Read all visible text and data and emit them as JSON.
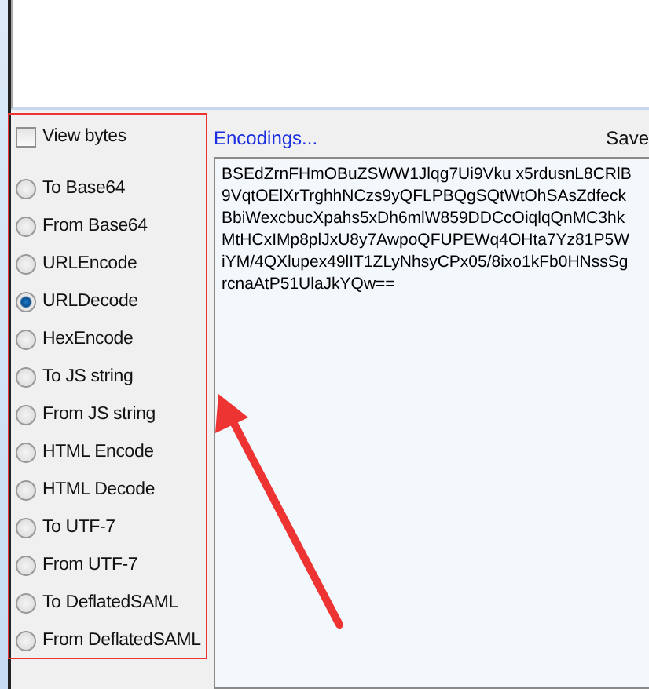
{
  "options": {
    "view_bytes": {
      "label": "View bytes",
      "checked": false
    },
    "transforms": [
      {
        "label": "To Base64",
        "selected": false
      },
      {
        "label": "From Base64",
        "selected": false
      },
      {
        "label": "URLEncode",
        "selected": false
      },
      {
        "label": "URLDecode",
        "selected": true
      },
      {
        "label": "HexEncode",
        "selected": false
      },
      {
        "label": "To JS string",
        "selected": false
      },
      {
        "label": "From JS string",
        "selected": false
      },
      {
        "label": "HTML Encode",
        "selected": false
      },
      {
        "label": "HTML Decode",
        "selected": false
      },
      {
        "label": "To UTF-7",
        "selected": false
      },
      {
        "label": "From UTF-7",
        "selected": false
      },
      {
        "label": "To DeflatedSAML",
        "selected": false
      },
      {
        "label": "From DeflatedSAML",
        "selected": false
      }
    ]
  },
  "toolbar": {
    "encodings_link": "Encodings...",
    "save_button": "Save"
  },
  "output": {
    "lines": [
      "BSEdZrnFHmOBuZSWW1Jlqg7Ui9Vku x5rdusnL8CRlB",
      "9VqtOElXrTrghhNCzs9yQFLPBQgSQtWtOhSAsZdfeck",
      "BbiWexcbucXpahs5xDh6mlW859DDCcOiqlqQnMC3hk",
      "MtHCxIMp8plJxU8y7AwpoQFUPEWq4OHta7Yz81P5W",
      "iYM/4QXlupex49lIT1ZLyNhsyCPx05/8ixo1kFb0HNssSg",
      "rcnaAtP51UlaJkYQw=="
    ]
  }
}
